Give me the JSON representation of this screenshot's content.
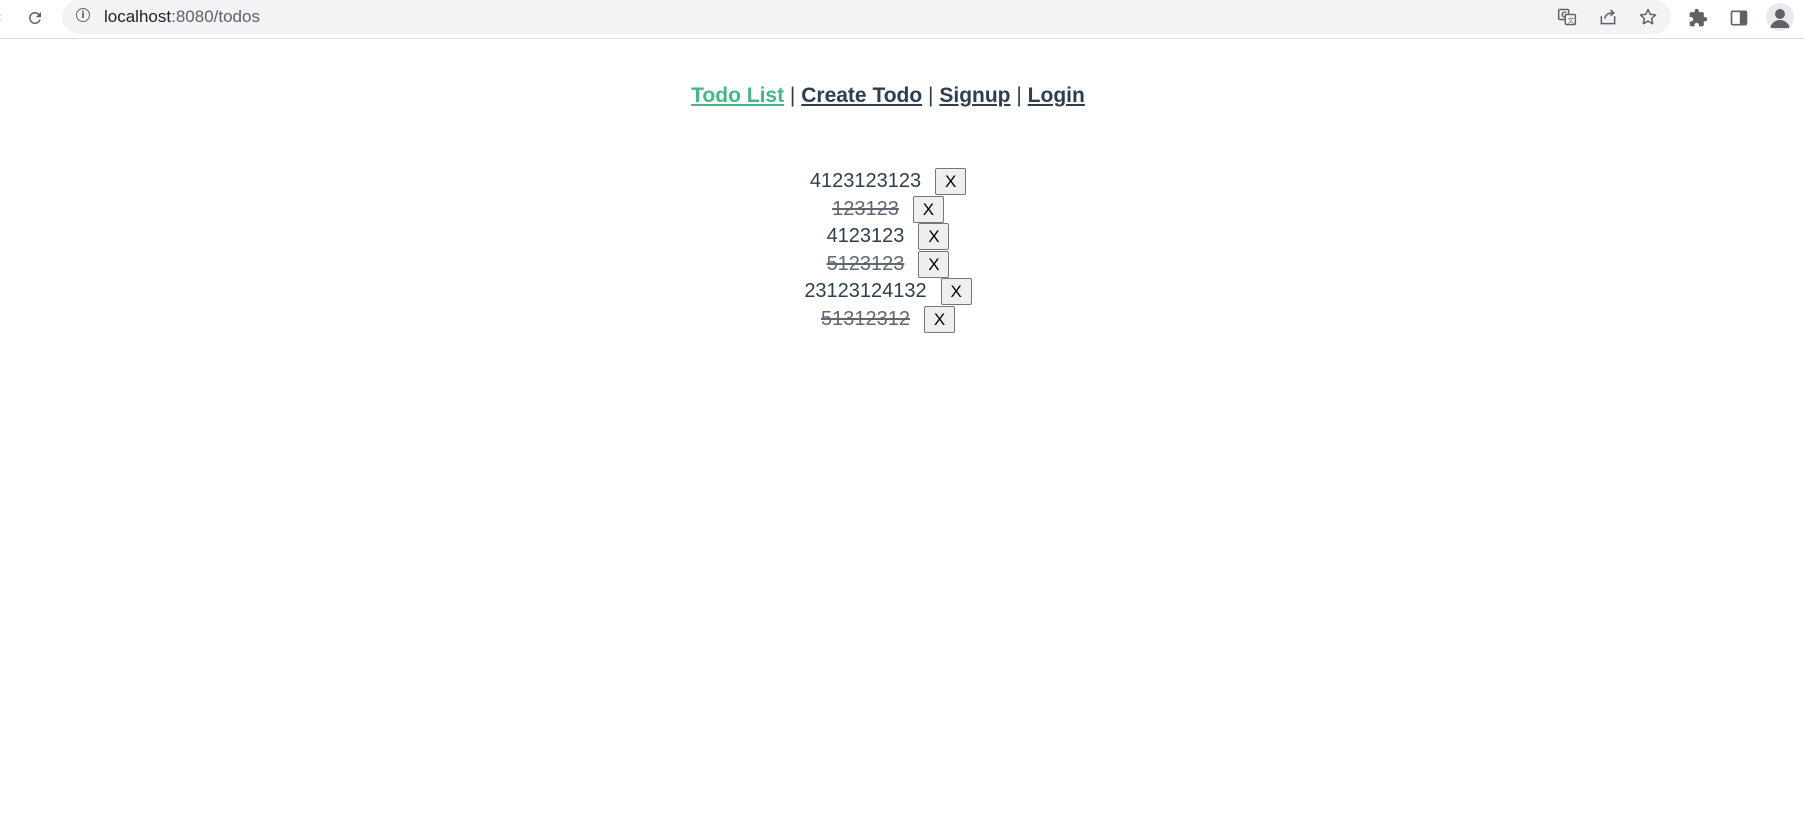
{
  "browser": {
    "url_host": "localhost",
    "url_rest": ":8080/todos"
  },
  "nav": {
    "items": [
      {
        "label": "Todo List",
        "active": true
      },
      {
        "label": "Create Todo",
        "active": false
      },
      {
        "label": "Signup",
        "active": false
      },
      {
        "label": "Login",
        "active": false
      }
    ],
    "separator": "|"
  },
  "todos": [
    {
      "text": "4123123123",
      "done": false,
      "delete_label": "X"
    },
    {
      "text": "123123",
      "done": true,
      "delete_label": "X"
    },
    {
      "text": "4123123",
      "done": false,
      "delete_label": "X"
    },
    {
      "text": "5123123",
      "done": true,
      "delete_label": "X"
    },
    {
      "text": "23123124132",
      "done": false,
      "delete_label": "X"
    },
    {
      "text": "51312312",
      "done": true,
      "delete_label": "X"
    }
  ],
  "colors": {
    "text": "#2c3e50",
    "active_link": "#42b983",
    "omnibox_bg": "#f1f3f4",
    "chrome_icon": "#5f6368"
  }
}
